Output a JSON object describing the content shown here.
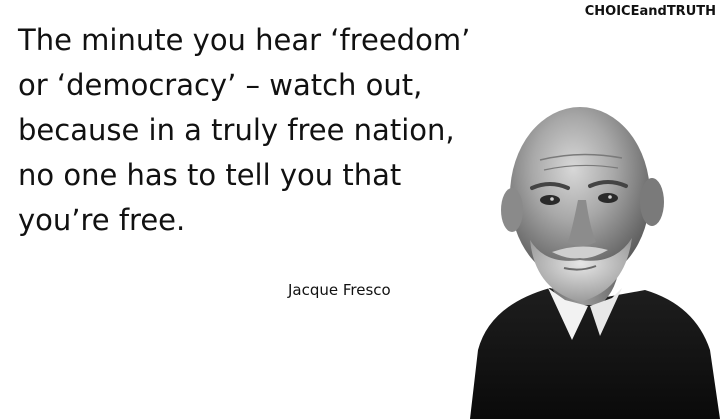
{
  "brand": "CHOICEandTRUTH",
  "quote_lines": [
    "The minute you hear ‘freedom’",
    "or ‘democracy’ – watch out,",
    "because in a truly free nation,",
    "no one has to tell you that",
    "you’re free."
  ],
  "author": "Jacque Fresco",
  "portrait": {
    "subject": "elderly bald man with white beard wearing dark sweater",
    "style": "black-and-white photograph"
  }
}
